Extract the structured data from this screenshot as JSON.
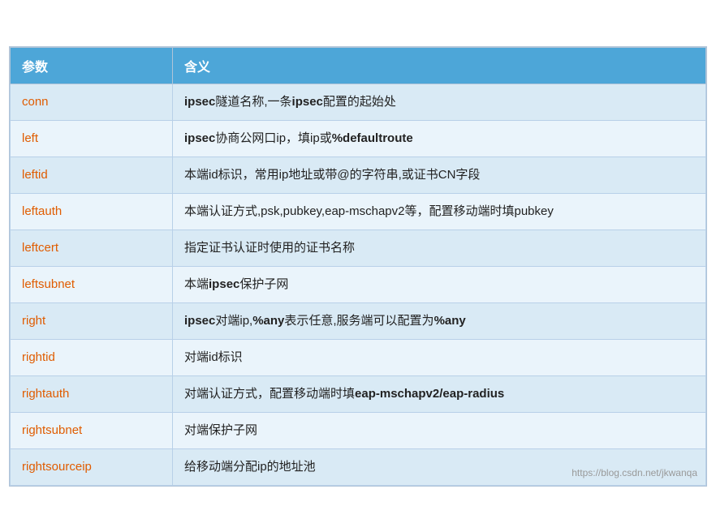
{
  "table": {
    "headers": [
      "参数",
      "含义"
    ],
    "rows": [
      {
        "param": "conn",
        "desc": "ipsec隧道名称,一条ipsec配置的起始处",
        "desc_parts": [
          {
            "text": "ipsec",
            "bold": true
          },
          {
            "text": "隧道名称,一条",
            "bold": false
          },
          {
            "text": "ipsec",
            "bold": true
          },
          {
            "text": "配置的起始处",
            "bold": false
          }
        ]
      },
      {
        "param": "left",
        "desc": "ipsec协商公网口ip，填ip或%defaultroute",
        "desc_parts": [
          {
            "text": "ipsec",
            "bold": true
          },
          {
            "text": "协商公网口ip，填ip或",
            "bold": false
          },
          {
            "text": "%defaultroute",
            "bold": true
          }
        ]
      },
      {
        "param": "leftid",
        "desc": "本端id标识，常用ip地址或带@的字符串,或证书CN字段",
        "desc_parts": [
          {
            "text": "本端id标识，常用ip地址或带@的字符串,或证书CN字段",
            "bold": false
          }
        ]
      },
      {
        "param": "leftauth",
        "desc": "本端认证方式,psk,pubkey,eap-mschapv2等，配置移动端时填pubkey",
        "desc_parts": [
          {
            "text": "本端认证方式,psk,pubkey,eap-mschapv2等，配置移动端时填pubkey",
            "bold": false
          }
        ]
      },
      {
        "param": "leftcert",
        "desc": "指定证书认证时使用的证书名称",
        "desc_parts": [
          {
            "text": "指定证书认证时使用的证书名称",
            "bold": false
          }
        ]
      },
      {
        "param": "leftsubnet",
        "desc": "本端ipsec保护子网",
        "desc_parts": [
          {
            "text": "本端",
            "bold": false
          },
          {
            "text": "ipsec",
            "bold": true
          },
          {
            "text": "保护子网",
            "bold": false
          }
        ]
      },
      {
        "param": "right",
        "desc": "ipsec对端ip,%any表示任意,服务端可以配置为%any",
        "desc_parts": [
          {
            "text": "ipsec",
            "bold": true
          },
          {
            "text": "对端ip,",
            "bold": false
          },
          {
            "text": "%any",
            "bold": true
          },
          {
            "text": "表示任意,服务端可以配置为",
            "bold": false
          },
          {
            "text": "%any",
            "bold": true
          }
        ]
      },
      {
        "param": "rightid",
        "desc": "对端id标识",
        "desc_parts": [
          {
            "text": "对端id标识",
            "bold": false
          }
        ]
      },
      {
        "param": "rightauth",
        "desc": "对端认证方式，配置移动端时填eap-mschapv2/eap-radius",
        "desc_parts": [
          {
            "text": "对端认证方式，配置移动端时填",
            "bold": false
          },
          {
            "text": "eap-mschapv2/eap-radius",
            "bold": true
          }
        ]
      },
      {
        "param": "rightsubnet",
        "desc": "对端保护子网",
        "desc_parts": [
          {
            "text": "对端保护子网",
            "bold": false
          }
        ]
      },
      {
        "param": "rightsourceip",
        "desc": "给移动端分配ip的地址池",
        "desc_parts": [
          {
            "text": "给移动端分配ip的地址池",
            "bold": false
          }
        ]
      }
    ],
    "watermark": "https://blog.csdn.net/jkwanqa"
  }
}
